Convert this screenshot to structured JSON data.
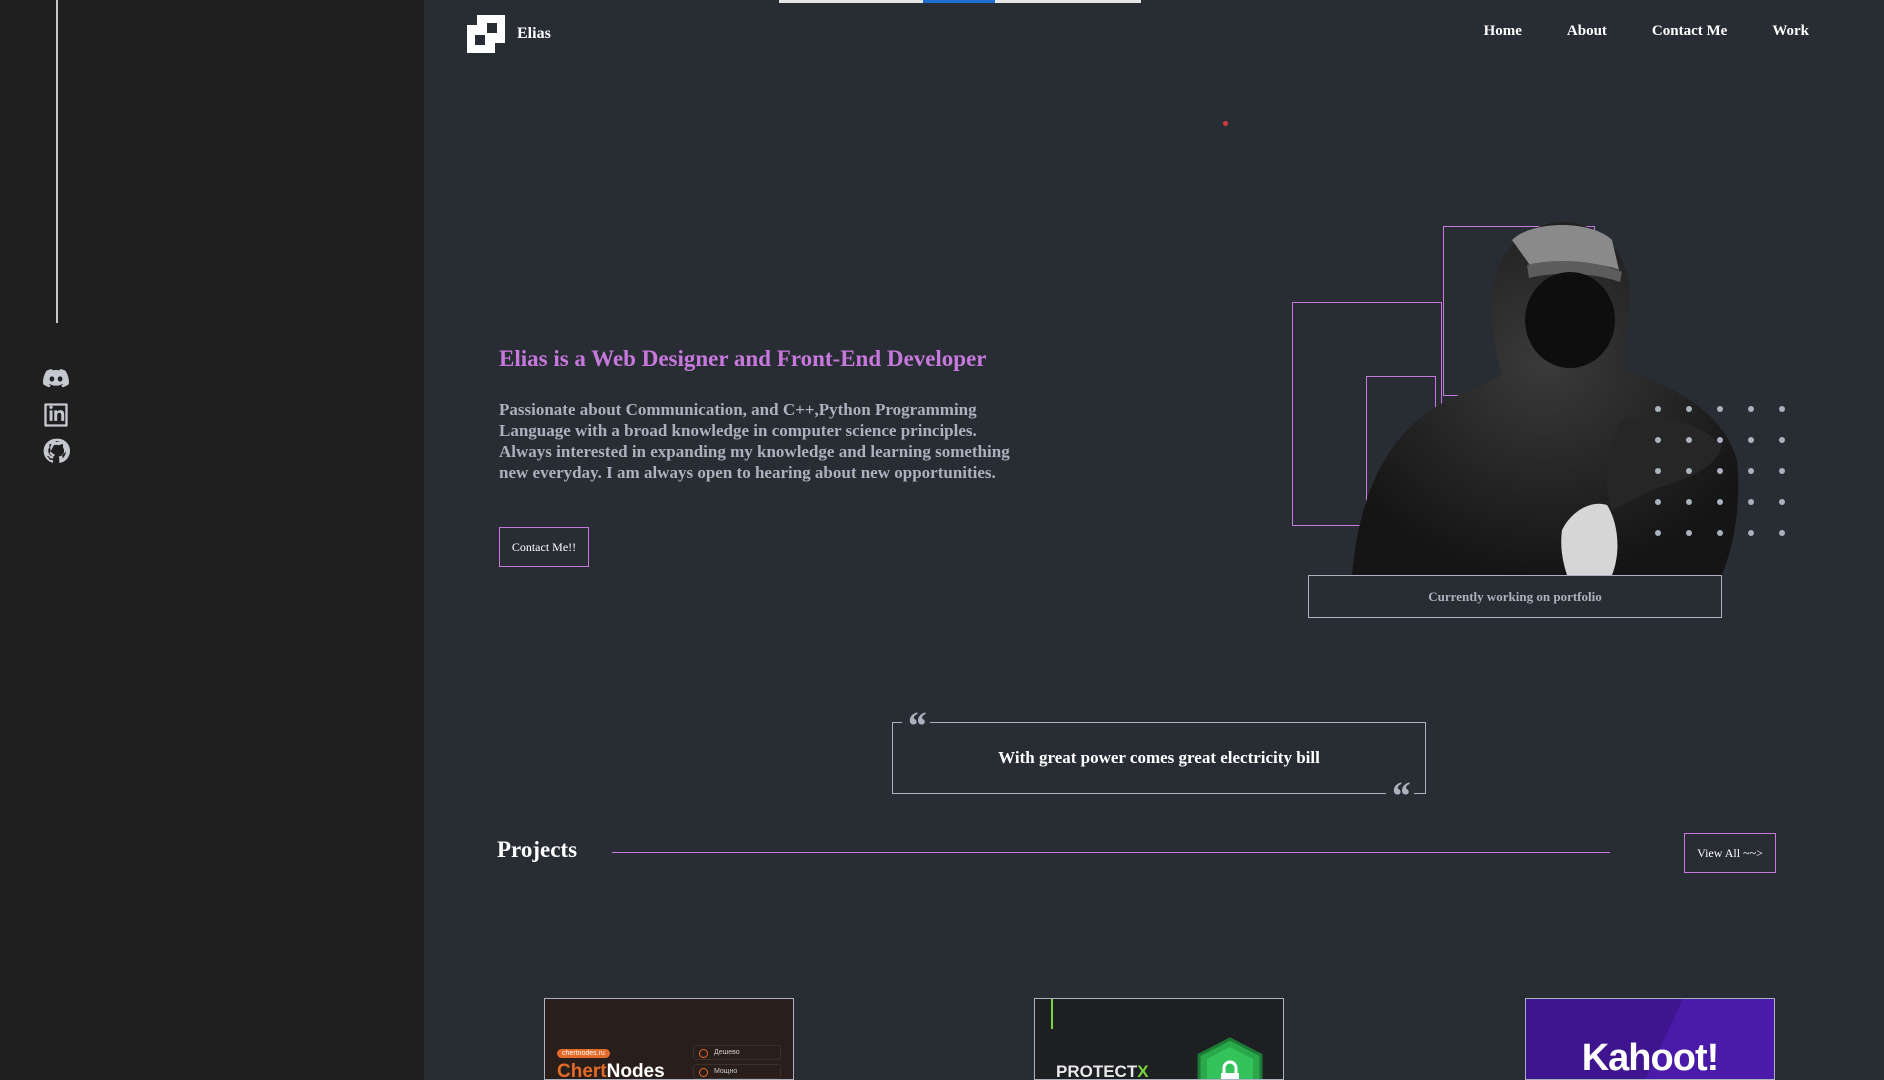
{
  "brand": {
    "name": "Elias"
  },
  "nav": {
    "items": [
      "Home",
      "About",
      "Contact Me",
      "Work"
    ]
  },
  "socials": [
    "discord-icon",
    "linkedin-icon",
    "github-icon"
  ],
  "hero": {
    "title": "Elias is a Web Designer and Front-End Developer",
    "description": "Passionate about Communication, and C++,Python Programming Language with a broad knowledge in computer science principles. Always interested in expanding my knowledge and learning something new everyday. I am always open to hearing about new opportunities.",
    "cta_label": "Contact Me!!",
    "status": "Currently working on portfolio"
  },
  "quote": {
    "text": "With great power comes great electricity bill"
  },
  "projects": {
    "title": "Projects",
    "view_all_label": "View All ~~>",
    "cards": [
      {
        "badge": "chertnodes.ru",
        "name_a": "Chert",
        "name_b": "Nodes",
        "items": [
          "Дешево",
          "Мощно"
        ]
      },
      {
        "name_a": "PROTECT",
        "name_b": "X"
      },
      {
        "name": "Kahoot!"
      }
    ]
  },
  "colors": {
    "accent": "#c778dd",
    "background": "#282c33",
    "sidebar": "#1f1f1f",
    "text_gray": "#abb2bf"
  }
}
